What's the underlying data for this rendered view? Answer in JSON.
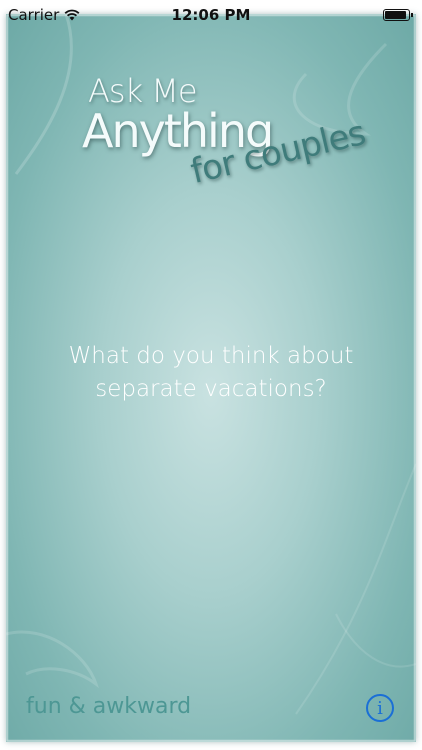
{
  "status_bar": {
    "carrier": "Carrier",
    "time": "12:06 PM",
    "battery_level": 0.95
  },
  "logo": {
    "line1": "Ask Me",
    "line2": "Anything",
    "subtitle": "for couples"
  },
  "question": {
    "line1": "What do you think about",
    "line2": "separate vacations?"
  },
  "footer": {
    "category": "fun & awkward",
    "info_icon": "i"
  },
  "colors": {
    "card_center": "#c9e2e1",
    "card_edge": "#6da9a6",
    "logo_text": "#f4fbfb",
    "subtitle_text": "#3f7c7b",
    "category_text": "#4d9794",
    "info_blue": "#1a6fd6"
  }
}
